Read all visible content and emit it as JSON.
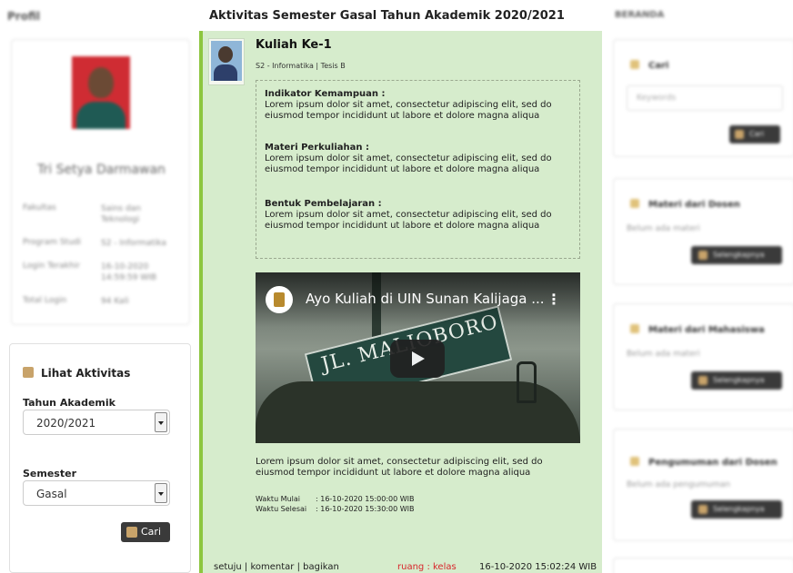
{
  "left": {
    "panel_title": "Profil",
    "profile_name": "Tri Setya Darmawan",
    "info": [
      {
        "key": "Fakultas",
        "value": "Sains dan Teknologi"
      },
      {
        "key": "Program Studi",
        "value": "S2 - Informatika"
      },
      {
        "key": "Login Terakhir",
        "value": "16-10-2020 14:59:59 WIB"
      },
      {
        "key": "Total Login",
        "value": "94 Kali"
      }
    ],
    "lihat": {
      "title": "Lihat Aktivitas",
      "tahun_label": "Tahun Akademik",
      "tahun_value": "2020/2021",
      "semester_label": "Semester",
      "semester_value": "Gasal",
      "button": "Cari"
    }
  },
  "main": {
    "title": "Aktivitas Semester Gasal Tahun Akademik 2020/2021",
    "activity": {
      "title": "Kuliah Ke-1",
      "subtitle": "S2 - Informatika | Tesis B",
      "indikator_label": "Indikator Kemampuan :",
      "indikator_text": "Lorem ipsum dolor sit amet, consectetur adipiscing elit, sed do eiusmod tempor incididunt ut labore et dolore magna aliqua",
      "materi_label": "Materi Perkuliahan :",
      "materi_text": "Lorem ipsum dolor sit amet, consectetur adipiscing elit, sed do eiusmod tempor incididunt ut labore et dolore magna aliqua",
      "bentuk_label": "Bentuk Pembelajaran :",
      "bentuk_text": "Lorem ipsum dolor sit amet, consectetur adipiscing elit, sed do eiusmod tempor incididunt ut labore et dolore magna aliqua",
      "video_title": "Ayo Kuliah di UIN Sunan Kalijaga ...",
      "video_sign_text": "JL. MALIOBORO",
      "video_menu": "⋮",
      "description": "Lorem ipsum dolor sit amet, consectetur adipiscing elit, sed do eiusmod tempor incididunt ut labore et dolore magna aliqua",
      "waktu_mulai_label": "Waktu Mulai",
      "waktu_mulai_value": ": 16-10-2020 15:00:00 WIB",
      "waktu_selesai_label": "Waktu Selesai",
      "waktu_selesai_value": ": 16-10-2020 15:30:00 WIB",
      "footer_links": "setuju | komentar | bagikan",
      "ruang": "ruang : kelas",
      "timestamp": "16-10-2020 15:02:24 WIB"
    }
  },
  "right": {
    "panel_title": "BERANDA",
    "cari": {
      "title": "Cari",
      "placeholder": "Keywords",
      "button": "Cari"
    },
    "cards": [
      {
        "title": "Materi dari Dosen",
        "note": "Belum ada materi",
        "button": "Selengkapnya"
      },
      {
        "title": "Materi dari Mahasiswa",
        "note": "Belum ada materi",
        "button": "Selengkapnya"
      },
      {
        "title": "Pengumuman dari Dosen",
        "note": "Belum ada pengumuman",
        "button": "Selengkapnya"
      }
    ]
  },
  "colors": {
    "activity_bg": "#d6eccc",
    "activity_border": "#8dc63f",
    "ruang_red": "#d8262b",
    "button_dark": "#3a3a3a"
  }
}
